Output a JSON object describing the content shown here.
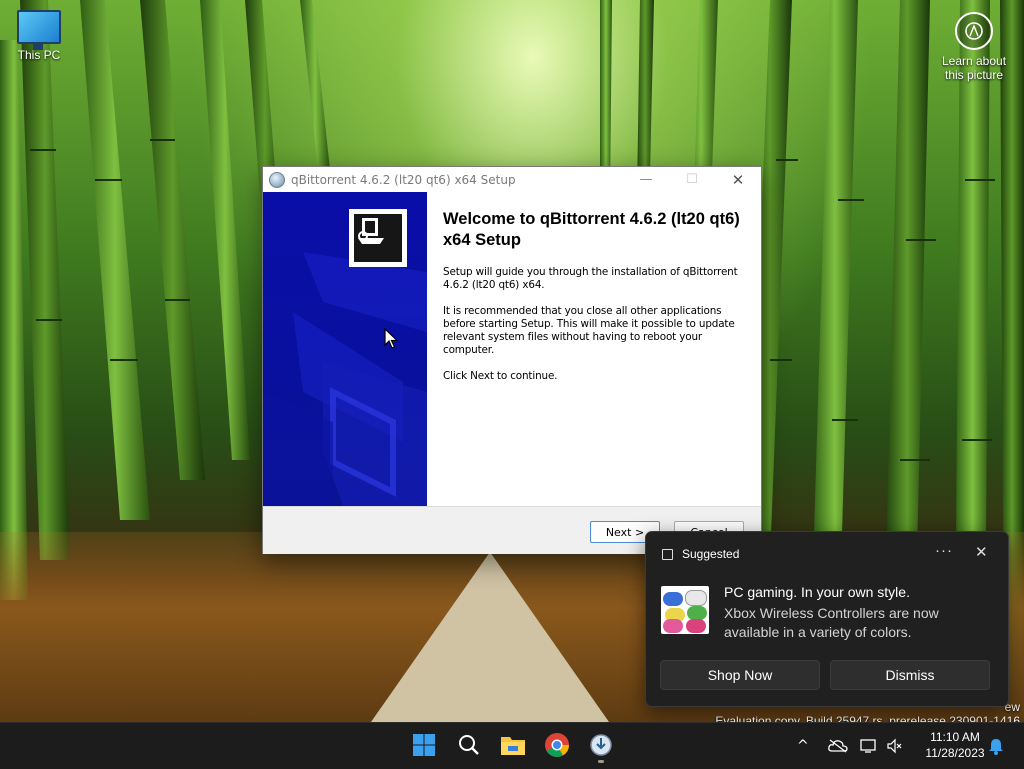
{
  "desktop": {
    "icons": [
      {
        "label": "This PC",
        "icon": "monitor-icon"
      },
      {
        "label": "Learn about this picture",
        "icon": "camera-lens-icon"
      }
    ],
    "watermark": {
      "line1": "ew",
      "line2": "Evaluation copy. Build 25947.rs_prerelease.230901-1416"
    }
  },
  "installer": {
    "title": "qBittorrent 4.6.2 (lt20 qt6) x64 Setup",
    "heading": "Welcome to qBittorrent 4.6.2 (lt20 qt6) x64 Setup",
    "paragraphs": [
      "Setup will guide you through the installation of qBittorrent 4.6.2 (lt20 qt6) x64.",
      "It is recommended that you close all other applications before starting Setup. This will make it possible to update relevant system files without having to reboot your computer.",
      "Click Next to continue."
    ],
    "buttons": {
      "next": "Next >",
      "cancel": "Cancel"
    },
    "titlebar_buttons": {
      "minimize": "—",
      "maximize": "☐",
      "close": "✕"
    }
  },
  "notification": {
    "header": "Suggested",
    "more": "···",
    "close": "✕",
    "title": "PC gaming. In your own style.",
    "body": "Xbox Wireless Controllers are now available in a variety of colors.",
    "buttons": {
      "primary": "Shop Now",
      "secondary": "Dismiss"
    }
  },
  "taskbar": {
    "apps": [
      {
        "name": "Start",
        "icon": "windows-start-icon"
      },
      {
        "name": "Search",
        "icon": "search-icon"
      },
      {
        "name": "File Explorer",
        "icon": "folder-icon"
      },
      {
        "name": "Chrome",
        "icon": "chrome-icon"
      },
      {
        "name": "qBittorrent Setup",
        "icon": "installer-icon"
      }
    ],
    "tray": {
      "overflow": "^",
      "time": "11:10 AM",
      "date": "11/28/2023"
    }
  }
}
